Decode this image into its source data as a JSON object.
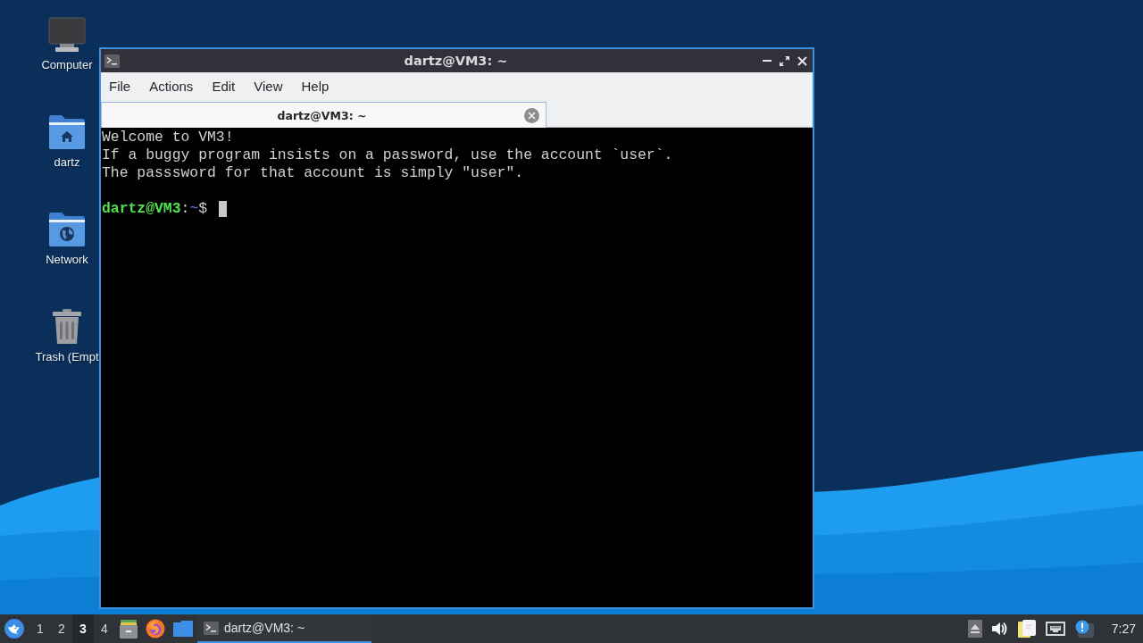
{
  "desktop_icons": [
    {
      "label": "Computer",
      "kind": "computer"
    },
    {
      "label": "dartz",
      "kind": "home"
    },
    {
      "label": "Network",
      "kind": "network"
    },
    {
      "label": "Trash (Empt",
      "kind": "trash"
    }
  ],
  "window": {
    "title": "dartz@VM3: ~",
    "menu": [
      "File",
      "Actions",
      "Edit",
      "View",
      "Help"
    ],
    "tabs": [
      {
        "label": "dartz@VM3: ~",
        "selected": true
      }
    ],
    "terminal": {
      "lines": [
        "Welcome to VM3!",
        "If a buggy program insists on a password, use the account `user`.",
        "The passsword for that account is simply \"user\"."
      ],
      "prompt": {
        "user_host": "dartz@VM3",
        "separator": ":",
        "path": "~",
        "symbol": "$"
      }
    }
  },
  "taskbar": {
    "workspaces": [
      {
        "label": "1",
        "selected": false
      },
      {
        "label": "2",
        "selected": false
      },
      {
        "label": "3",
        "selected": true
      },
      {
        "label": "4",
        "selected": false
      }
    ],
    "tasks": [
      {
        "title": "dartz@VM3: ~",
        "active": true
      }
    ],
    "clock": "7:27"
  }
}
